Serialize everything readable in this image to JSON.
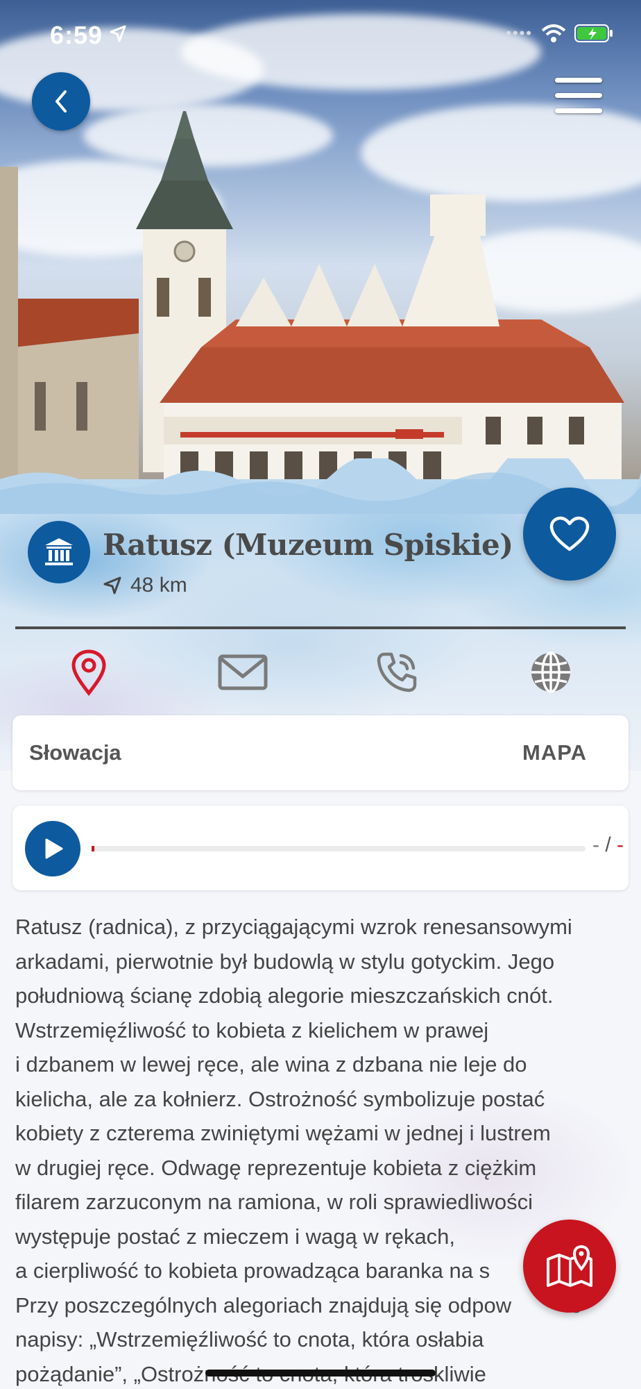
{
  "status_bar": {
    "time": "6:59"
  },
  "header": {
    "back_label": "Back",
    "menu_label": "Menu"
  },
  "place": {
    "title": "Ratusz (Muzeum Spiskie)",
    "category_icon": "museum-icon",
    "distance": "48 km",
    "favorite_icon": "heart-icon"
  },
  "contact_icons": [
    "location-pin-icon",
    "mail-icon",
    "phone-icon",
    "globe-icon"
  ],
  "colors": {
    "accent_blue": "#0d5a9f",
    "accent_red": "#c8141e",
    "text": "#444444"
  },
  "location_card": {
    "country": "Słowacja",
    "map_label": "MAPA"
  },
  "audio": {
    "elapsed": "-",
    "separator": "/",
    "duration": "-",
    "progress": 0
  },
  "description": {
    "lines": [
      "Ratusz (radnica), z przyciągającymi wzrok renesansowymi",
      "arkadami, pierwotnie był budowlą w stylu gotyckim. Jego",
      "południową ścianę zdobią alegorie mieszczańskich cnót.",
      "Wstrzemięźliwość to kobieta z kielichem w prawej",
      "i dzbanem w lewej ręce, ale wina z dzbana nie leje do",
      "kielicha, ale za kołnierz. Ostrożność symbolizuje postać",
      "kobiety z czterema zwiniętymi wężami w jednej i lustrem",
      "w drugiej ręce. Odwagę reprezentuje kobieta z ciężkim",
      "filarem zarzuconym na ramiona, w roli sprawiedliwości",
      "występuje postać z mieczem i wagą w rękach,",
      "a cierpliwość to kobieta prowadząca baranka na s",
      "Przy poszczególnych alegoriach znajdują się odpow         ie",
      "napisy: „Wstrzemięźliwość to cnota, która osłabia",
      "pożądanie”, „Ostrożność to cnota, która troskliwie"
    ]
  },
  "map_fab_icon": "map-pin-icon"
}
